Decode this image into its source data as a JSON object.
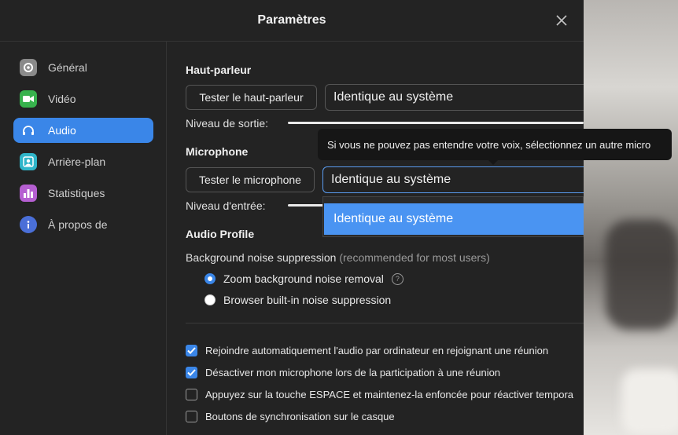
{
  "window": {
    "title": "Paramètres"
  },
  "sidebar": {
    "items": [
      {
        "label": "Général",
        "icon": "gear-icon",
        "color": "#8a8a8a"
      },
      {
        "label": "Vidéo",
        "icon": "video-icon",
        "color": "#37b24d"
      },
      {
        "label": "Audio",
        "icon": "headphones-icon",
        "color": "#3a86e8",
        "active": true
      },
      {
        "label": "Arrière-plan",
        "icon": "background-icon",
        "color": "#2fb5c9"
      },
      {
        "label": "Statistiques",
        "icon": "stats-icon",
        "color": "#b55fd1"
      },
      {
        "label": "À propos de",
        "icon": "info-icon",
        "color": "#4a6fd8"
      }
    ]
  },
  "speaker": {
    "heading": "Haut-parleur",
    "test_label": "Tester le haut-parleur",
    "device": "Identique au système",
    "level_label": "Niveau de sortie:"
  },
  "microphone": {
    "heading": "Microphone",
    "test_label": "Tester le microphone",
    "device": "Identique au système",
    "level_label": "Niveau d'entrée:",
    "tooltip": "Si vous ne pouvez pas entendre votre voix, sélectionnez un autre micro",
    "dropdown_options": [
      "Identique au système"
    ]
  },
  "profile": {
    "heading": "Audio Profile",
    "noise_label": "Background noise suppression",
    "noise_note": "(recommended for most users)",
    "options": [
      {
        "label": "Zoom background noise removal",
        "selected": true
      },
      {
        "label": "Browser built-in noise suppression",
        "selected": false
      }
    ]
  },
  "checkboxes": [
    {
      "label": "Rejoindre automatiquement l'audio par ordinateur en rejoignant une réunion",
      "checked": true
    },
    {
      "label": "Désactiver mon microphone lors de la participation à une réunion",
      "checked": true
    },
    {
      "label": "Appuyez sur la touche ESPACE et maintenez-la enfoncée pour réactiver tempora",
      "checked": false
    },
    {
      "label": "Boutons de synchronisation sur le casque",
      "checked": false
    }
  ],
  "colors": {
    "accent": "#3a86e8",
    "panel": "#232323"
  }
}
